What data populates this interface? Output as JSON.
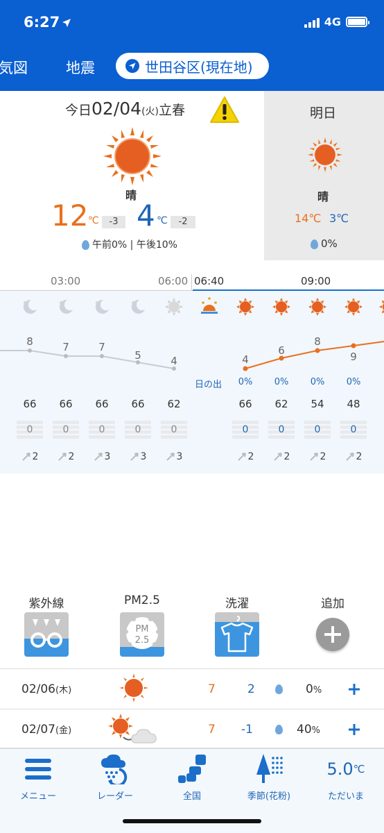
{
  "status_bar": {
    "time": "6:27",
    "network": "4G"
  },
  "header": {
    "tabs": [
      "気図",
      "地震"
    ],
    "location_pill": "世田谷区(現在地)"
  },
  "today": {
    "label_prefix": "今日",
    "date": "02/04",
    "weekday": "(火)",
    "note": "立春",
    "condition": "晴",
    "high": "12",
    "high_unit": "℃",
    "high_delta": "-3",
    "low": "4",
    "low_unit": "℃",
    "low_delta": "-2",
    "precip": "午前0% | 午後10%"
  },
  "tomorrow": {
    "label": "明日",
    "condition": "晴",
    "high": "14℃",
    "low": "3℃",
    "precip": "0%"
  },
  "timeline": {
    "labels": [
      "03:00",
      "06:00",
      "06:40",
      "09:00"
    ],
    "sunrise_label": "日の出"
  },
  "hourly": {
    "night_temps": [
      "8",
      "7",
      "7",
      "5",
      "4"
    ],
    "day_temps": [
      "4",
      "6",
      "8",
      "9"
    ],
    "precip_pct": [
      "0%",
      "0%",
      "0%",
      "0%"
    ],
    "humidity": [
      "66",
      "66",
      "66",
      "66",
      "62",
      "66",
      "62",
      "54",
      "48"
    ],
    "rain": [
      "0",
      "0",
      "0",
      "0",
      "0",
      "0",
      "0",
      "0",
      "0"
    ],
    "wind": [
      "2",
      "2",
      "3",
      "3",
      "3",
      "2",
      "2",
      "2",
      "2"
    ]
  },
  "indicators": [
    {
      "label": "紫外線",
      "icon": "uv-glasses-icon"
    },
    {
      "label": "PM2.5",
      "icon": "pm25-icon",
      "text": "PM\n2.5"
    },
    {
      "label": "洗濯",
      "icon": "laundry-shirt-icon"
    },
    {
      "label": "追加",
      "icon": "add-plus-icon"
    }
  ],
  "week": [
    {
      "date": "02/06",
      "weekday": "(木)",
      "high": "7",
      "low": "2",
      "precip": "0",
      "pct": "%"
    },
    {
      "date": "02/07",
      "weekday": "(金)",
      "high": "7",
      "low": "-1",
      "precip": "40",
      "pct": "%"
    }
  ],
  "bottom_nav": [
    {
      "label": "メニュー",
      "icon": "menu-icon"
    },
    {
      "label": "レーダー",
      "icon": "radar-icon"
    },
    {
      "label": "全国",
      "icon": "japan-map-icon"
    },
    {
      "label": "季節(花粉)",
      "icon": "pollen-tree-icon"
    },
    {
      "label": "ただいま",
      "value": "5.0",
      "unit": "℃"
    }
  ],
  "colors": {
    "primary_blue": "#0a5fd1",
    "orange": "#e8701e",
    "temp_blue": "#1f66b8"
  }
}
